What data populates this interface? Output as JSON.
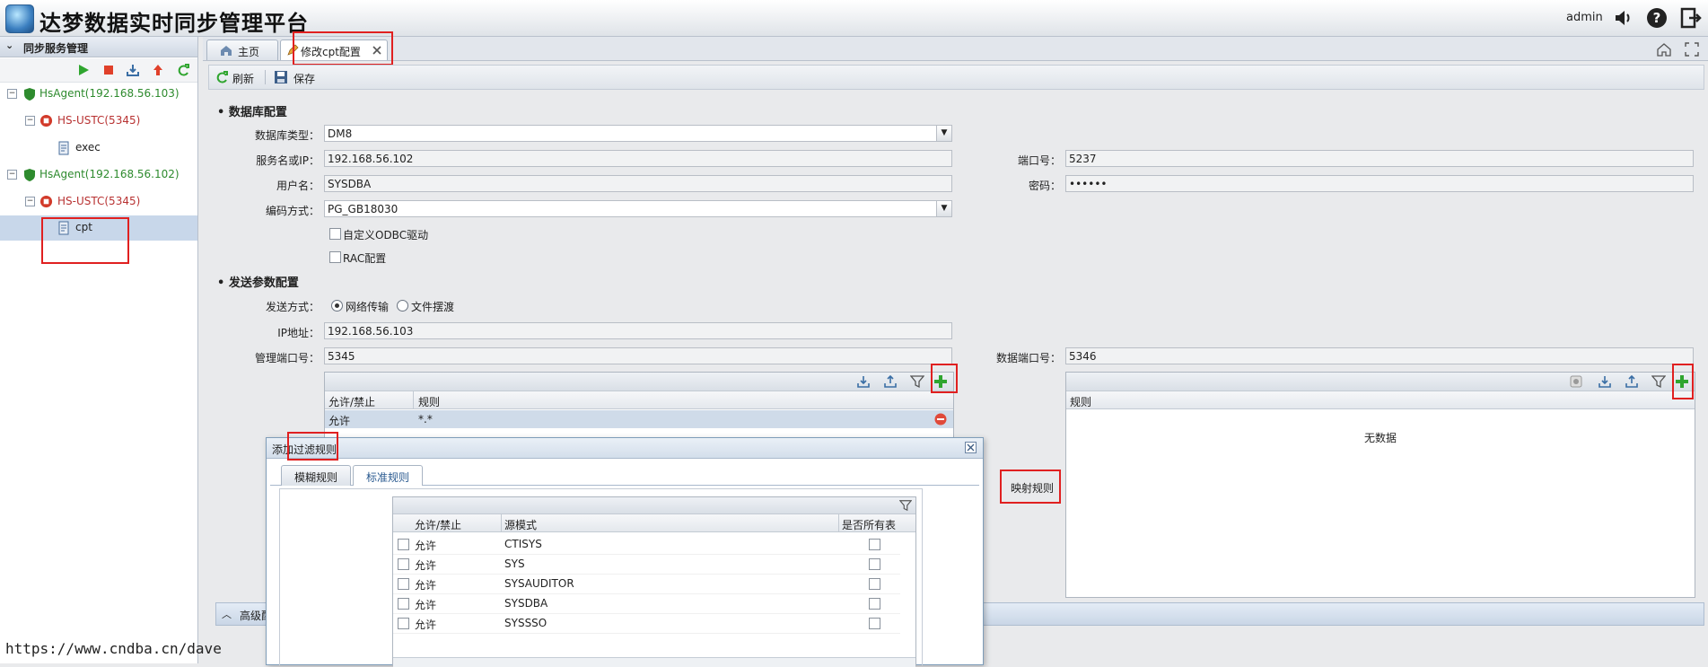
{
  "app": {
    "title": "达梦数据实时同步管理平台",
    "user": "admin"
  },
  "sidebar": {
    "title": "同步服务管理",
    "tree": [
      {
        "label": "HsAgent(192.168.56.103)"
      },
      {
        "label": "HS-USTC(5345)"
      },
      {
        "label": "exec"
      },
      {
        "label": "HsAgent(192.168.56.102)"
      },
      {
        "label": "HS-USTC(5345)"
      },
      {
        "label": "cpt"
      }
    ]
  },
  "tabs": [
    {
      "label": "主页"
    },
    {
      "label": "修改cpt配置"
    }
  ],
  "toolbar": {
    "refresh": "刷新",
    "save": "保存"
  },
  "db": {
    "section": "数据库配置",
    "type_label": "数据库类型：",
    "type_value": "DM8",
    "host_label": "服务名或IP：",
    "host_value": "192.168.56.102",
    "user_label": "用户名：",
    "user_value": "SYSDBA",
    "enc_label": "编码方式：",
    "enc_value": "PG_GB18030",
    "odbc_label": "自定义ODBC驱动",
    "rac_label": "RAC配置",
    "port_label": "端口号：",
    "port_value": "5237",
    "pwd_label": "密码：",
    "pwd_value": "••••••"
  },
  "send": {
    "section": "发送参数配置",
    "mode_label": "发送方式：",
    "mode_net": "网络传输",
    "mode_file": "文件摆渡",
    "ip_label": "IP地址：",
    "ip_value": "192.168.56.103",
    "mport_label": "管理端口号：",
    "mport_value": "5345",
    "dport_label": "数据端口号：",
    "dport_value": "5346"
  },
  "filter_grid": {
    "headers": [
      "允许/禁止",
      "规则"
    ],
    "rows": [
      {
        "allow": "允许",
        "rule": "*.*"
      }
    ]
  },
  "mapping": {
    "label": "映射规则",
    "header": "规则",
    "empty": "无数据"
  },
  "advanced": {
    "label": "高级配"
  },
  "dialog": {
    "title": "添加过滤规则",
    "tabs": [
      "模糊规则",
      "标准规则"
    ],
    "headers": [
      "允许/禁止",
      "源模式",
      "是否所有表"
    ],
    "rows": [
      {
        "allow": "允许",
        "schema": "CTISYS"
      },
      {
        "allow": "允许",
        "schema": "SYS"
      },
      {
        "allow": "允许",
        "schema": "SYSAUDITOR"
      },
      {
        "allow": "允许",
        "schema": "SYSDBA"
      },
      {
        "allow": "允许",
        "schema": "SYSSSO"
      }
    ]
  },
  "watermark": "https://www.cndba.cn/dave"
}
